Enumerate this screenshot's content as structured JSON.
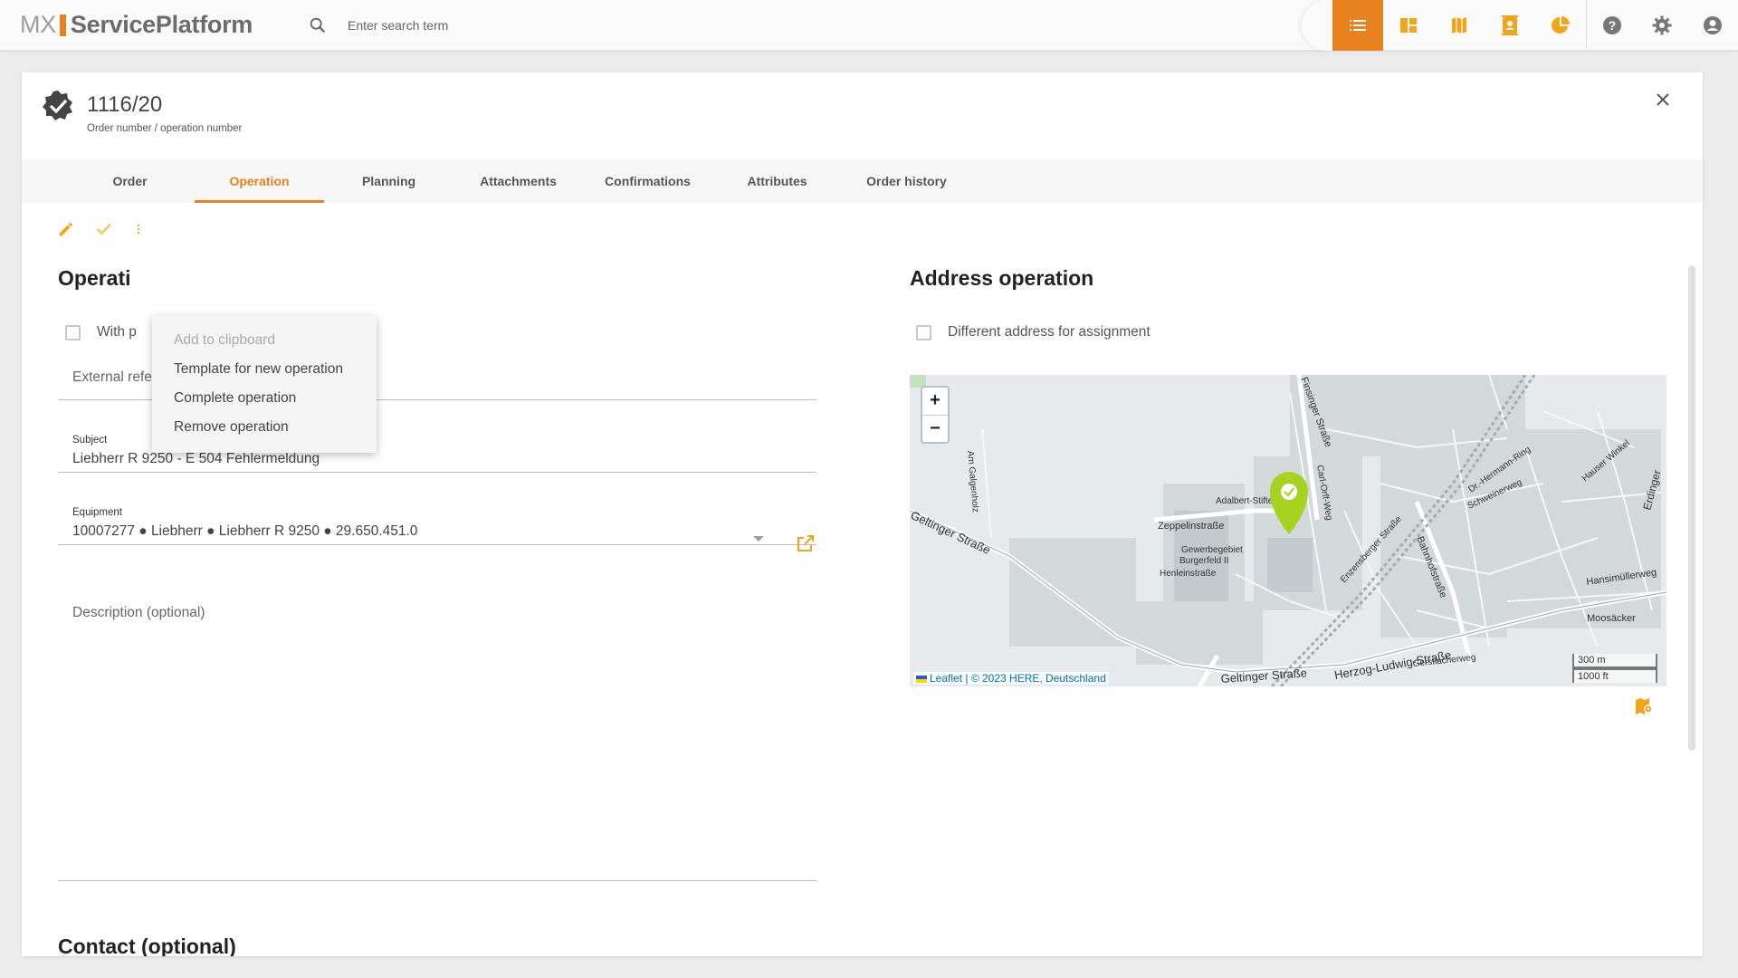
{
  "app": {
    "logo_prefix": "MX",
    "logo_name": "ServicePlatform"
  },
  "search": {
    "placeholder": "Enter search term"
  },
  "topbar": {
    "icons": [
      "list-view-icon",
      "dashboard-icon",
      "map-icon",
      "contacts-icon",
      "pie-chart-icon",
      "help-icon",
      "gear-icon",
      "account-icon"
    ],
    "active": "list-view-icon",
    "accent": "#e8821e"
  },
  "header": {
    "order_number": "1116/20",
    "order_subtitle": "Order number / operation number"
  },
  "tabs": [
    {
      "label": "Order"
    },
    {
      "label": "Operation",
      "active": true
    },
    {
      "label": "Planning"
    },
    {
      "label": "Attachments"
    },
    {
      "label": "Confirmations"
    },
    {
      "label": "Attributes"
    },
    {
      "label": "Order history"
    }
  ],
  "menu": {
    "items": [
      {
        "label": "Add to clipboard",
        "disabled": true
      },
      {
        "label": "Template for new operation"
      },
      {
        "label": "Complete operation"
      },
      {
        "label": "Remove operation"
      }
    ]
  },
  "operation": {
    "title": "Operati",
    "with_p_label": "With p",
    "external_ref_placeholder": "External reference (optional)",
    "subject_label": "Subject",
    "subject_value": "Liebherr R 9250 - E 504 Fehlermeldung",
    "equipment_label": "Equipment",
    "equipment_value": "10007277 ● Liebherr ● Liebherr R 9250 ● 29.650.451.0",
    "description_placeholder": "Description (optional)"
  },
  "address": {
    "title": "Address operation",
    "different_address_label": "Different address for assignment"
  },
  "map": {
    "zoom_in": "+",
    "zoom_out": "−",
    "attribution_leaflet": "Leaflet",
    "attribution_rest": " | © 2023 HERE, Deutschland",
    "scale_metric": "300 m",
    "scale_imperial": "1000 ft",
    "streets": [
      "Geltinger Straße",
      "Herzog-Ludwig-Straße",
      "Geltinger Straße",
      "Zeppelinstraße",
      "Am Galgenholz",
      "Finsinger Straße",
      "Bahnhofstraße",
      "Moosäcker",
      "Hansimüllerweg",
      "Schweinerweg",
      "Burgerfeld II",
      "Gewerbegebiet",
      "Henleinstraße",
      "Adalbert-Stifter",
      "Carl-Orff-Weg",
      "Erdinger",
      "Hauser Winkel",
      "Gerstlacherweg",
      "Dr.-Hermann-Ring",
      "Enzensberger Straße"
    ],
    "marker_color": "#a6d31f"
  },
  "contact": {
    "title": "Contact (optional)"
  }
}
